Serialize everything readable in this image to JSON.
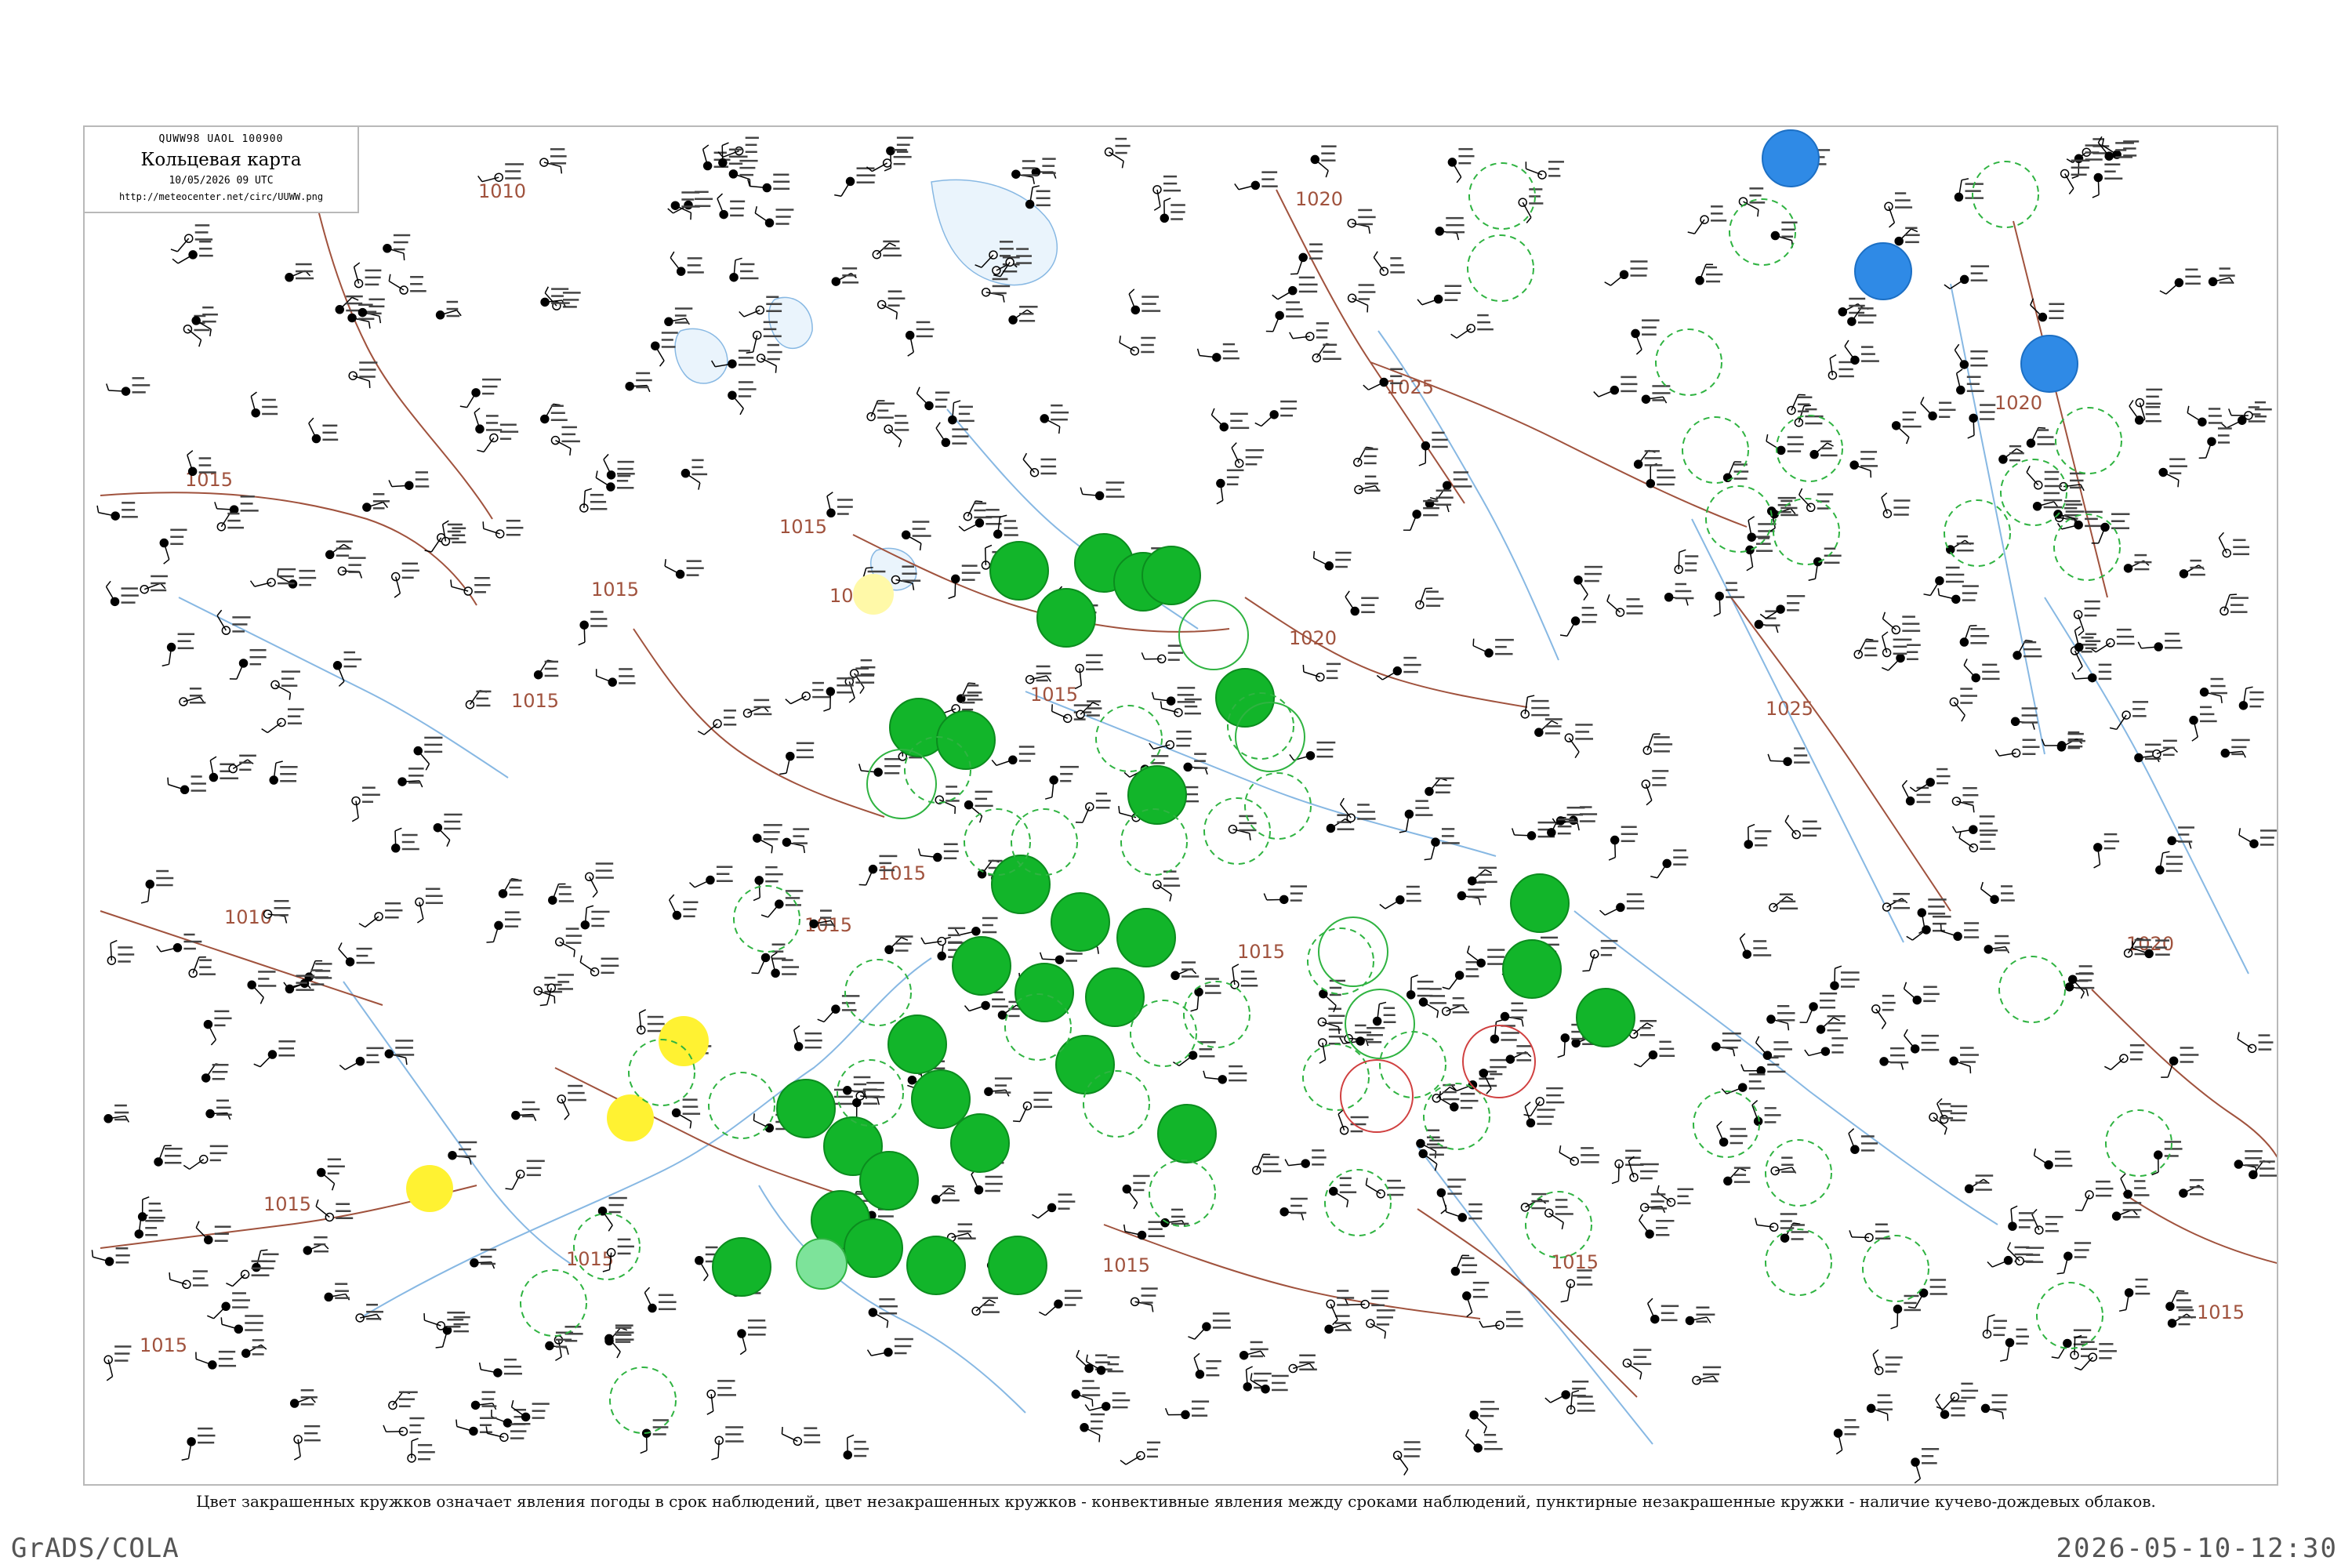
{
  "header": {
    "bulletin_code": "QUWW98  UAOL  100900",
    "title": "Кольцевая карта",
    "datetime": "10/05/2026 09 UTC",
    "url": "http://meteocenter.net/circ/UUWW.png"
  },
  "isobar_labels": [
    "1010",
    "1015",
    "1015",
    "1015",
    "1015",
    "1015",
    "1015",
    "1020",
    "1020",
    "1025",
    "1015",
    "1015",
    "1010",
    "1015",
    "1015",
    "1015",
    "1015",
    "1025",
    "1020",
    "1020",
    "1015",
    "1015",
    "1015"
  ],
  "legend_caption": "Цвет закрашенных кружков означает явления погоды в срок наблюдений, цвет незакрашенных кружков - конвективные явления между сроками наблюдений, пунктирные незакрашенные кружки - наличие кучево-дождевых облаков.",
  "footer": {
    "software": "GrADS/COLA",
    "timestamp": "2026-05-10-12:30"
  },
  "colors": {
    "isobar": "#a0523d",
    "river": "#87b8e3",
    "rain_fill": "#12b52a",
    "rain_ring": "#0b8c1e",
    "light_rain_fill": "#7de39a",
    "haze_fill": "#fff232",
    "snow_fill": "#2f8ae6",
    "cb_dashed": "#2fb341",
    "thunder_ring": "#d04040",
    "frame": "#b9b9b9"
  },
  "symbol_legend": {
    "filled_green": "rain",
    "filled_light_green": "light-rain",
    "filled_yellow": "haze",
    "filled_blue": "snow",
    "dashed_green_ring": "cumulonimbus",
    "solid_green_ring": "convective-rain-between-obs",
    "red_ring": "thunderstorm-between-obs"
  }
}
